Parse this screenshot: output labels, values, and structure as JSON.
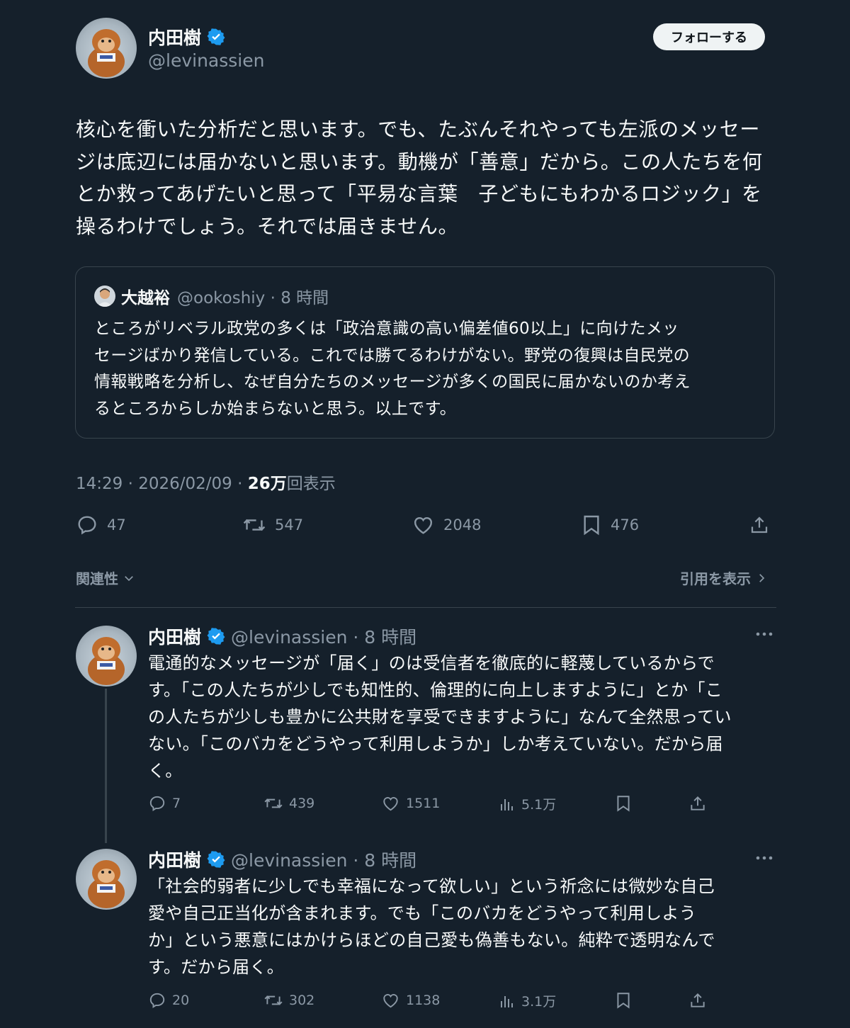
{
  "author": {
    "name": "内田樹",
    "handle": "@levinassien"
  },
  "follow_label": "フォローする",
  "post": {
    "lines": [
      "核心を衝いた分析だと思います。でも、たぶんそれやっても左派のメッセー",
      "ジは底辺には届かないと思います。動機が「善意」だから。この人たちを何",
      "とか救ってあげたいと思って「平易な言葉　子どもにもわかるロジック」を",
      "操るわけでしょう。それでは届きません。"
    ],
    "time": "14:29 · 2026/02/09 · ",
    "views_count": "26万",
    "views_label": "回表示",
    "actions": {
      "replies": "47",
      "reposts": "547",
      "likes": "2048",
      "bookmarks": "476"
    }
  },
  "quote": {
    "name": "大越裕",
    "handle_time": "@ookoshiy · 8 時間",
    "lines": [
      "ところがリベラル政党の多くは「政治意識の高い偏差値60以上」に向けたメッ",
      "セージばかり発信している。これでは勝てるわけがない。野党の復興は自民党の",
      "情報戦略を分析し、なぜ自分たちのメッセージが多くの国民に届かないのか考え",
      "るところからしか始まらないと思う。以上です。"
    ]
  },
  "sort_label": "関連性",
  "quotes_link": "引用を表示",
  "replies": [
    {
      "name": "内田樹",
      "handle_time": "@levinassien · 8 時間",
      "lines": [
        "電通的なメッセージが「届く」のは受信者を徹底的に軽蔑しているからで",
        "す。「この人たちが少しでも知性的、倫理的に向上しますように」とか「こ",
        "の人たちが少しも豊かに公共財を享受できますように」なんて全然思ってい",
        "ない。「このバカをどうやって利用しようか」しか考えていない。だから届",
        "く。"
      ],
      "replies": "7",
      "reposts": "439",
      "likes": "1511",
      "views": "5.1万"
    },
    {
      "name": "内田樹",
      "handle_time": "@levinassien · 8 時間",
      "lines": [
        "「社会的弱者に少しでも幸福になって欲しい」という祈念には微妙な自己",
        "愛や自己正当化が含まれます。でも「このバカをどうやって利用しよう",
        "か」という悪意にはかけらほどの自己愛も偽善もない。純粋で透明なんで",
        "す。だから届く。"
      ],
      "replies": "20",
      "reposts": "302",
      "likes": "1138",
      "views": "3.1万"
    }
  ],
  "colors": {
    "background": "#15202b",
    "text": "#f7f9f9",
    "muted": "#8b98a5",
    "border": "#38444d",
    "verified": "#1d9bf0"
  }
}
